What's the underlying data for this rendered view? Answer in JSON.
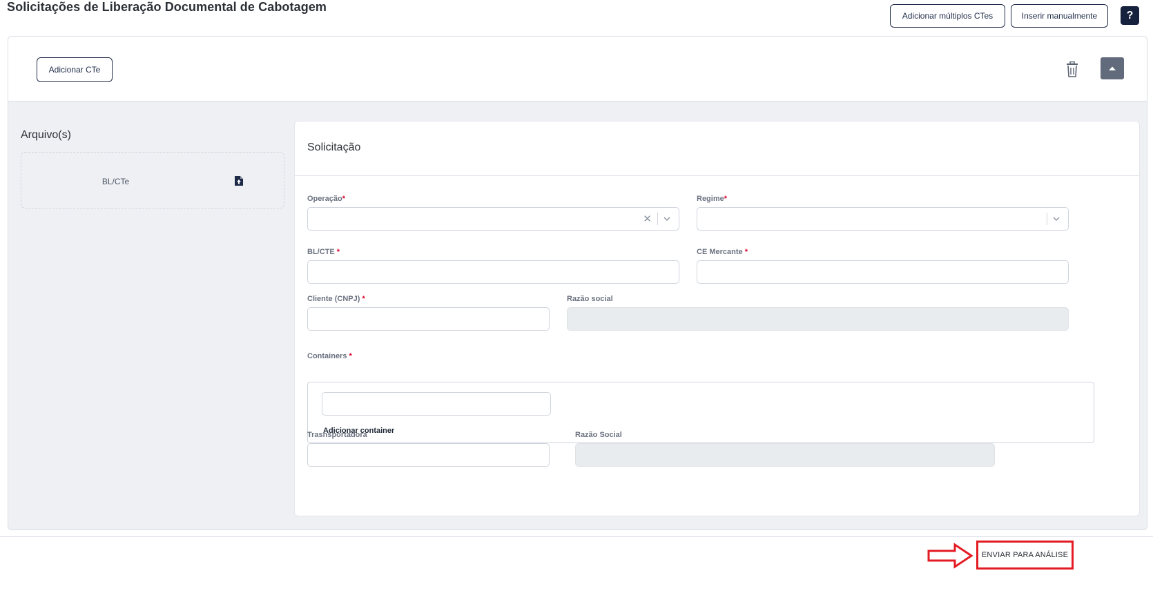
{
  "header": {
    "title": "Solicitações de Liberação Documental de Cabotagem",
    "add_multiple_label": "Adicionar múltiplos CTes",
    "insert_manual_label": "Inserir manualmente",
    "help_label": "?"
  },
  "card": {
    "add_cte_label": "Adicionar CTe",
    "icons": {
      "delete": "trash-icon",
      "collapse": "caret-up-icon"
    }
  },
  "files": {
    "title": "Arquivo(s)",
    "dropzone_label": "BL/CTe",
    "icon": "file-upload-icon"
  },
  "form": {
    "title": "Solicitação",
    "operacao_label": "Operação",
    "regime_label": "Regime",
    "bl_cte_label": "BL/CTE",
    "ce_mercante_label": "CE Mercante",
    "cliente_label": "Cliente (CNPJ)",
    "razao_social_label": "Razão social",
    "containers_label": "Containers",
    "add_container_label": "Adicionar container",
    "transportadora_label": "Trasnsportadora",
    "razao_social_transp_label": "Razão Social",
    "required_mark": "*"
  },
  "footer": {
    "send_label": "ENVIAR PARA ANÁLISE"
  },
  "colors": {
    "accent": "#1e2a47",
    "highlight": "#e31b23",
    "collapse_bg": "#616b7c"
  }
}
